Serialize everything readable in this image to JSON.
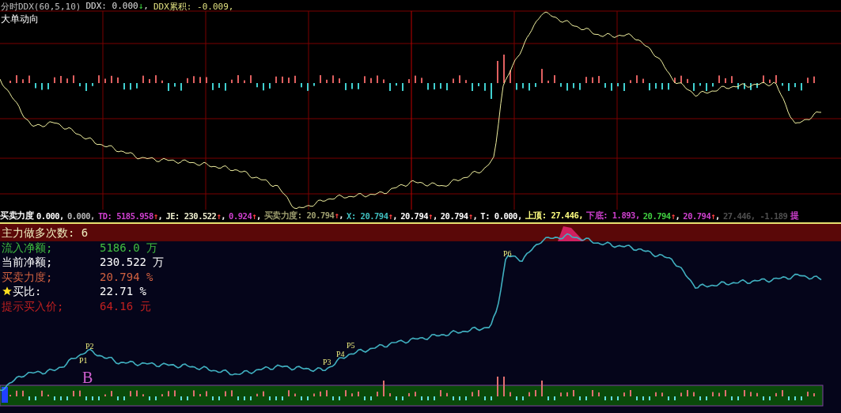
{
  "top_panel": {
    "indicator": "分时DDX(60,5,10)",
    "readouts": [
      {
        "label": "DDX:",
        "value": "0.000",
        "arrow": "↓",
        "tail": ",",
        "kind": "plain"
      },
      {
        "label": "DDX累积:",
        "value": "-0.009,",
        "kind": "accent"
      }
    ],
    "subtitle": "大单动向"
  },
  "info_bar": [
    {
      "text": "买卖力度",
      "color": "#ffffff"
    },
    {
      "text": "0.000,",
      "color": "#ffffff"
    },
    {
      "text": "0.000,",
      "color": "#b8b8b8"
    },
    {
      "text": "TD: 5185.958",
      "color": "#d040d0",
      "arrow": "↑",
      "tail": ","
    },
    {
      "text": "JE: 230.522",
      "color": "#f0f0d0",
      "arrow": "↑",
      "tail": ","
    },
    {
      "text": "0.924",
      "color": "#d040d0",
      "arrow": "↑",
      "tail": ","
    },
    {
      "text": "买卖力度: 20.794",
      "color": "#a0a070",
      "arrow": "↑",
      "tail": ","
    },
    {
      "text": "X: 20.794",
      "color": "#40c0c0",
      "arrow": "↑",
      "tail": ","
    },
    {
      "text": "20.794",
      "color": "#ffffff",
      "arrow": "↑",
      "tail": ","
    },
    {
      "text": "20.794",
      "color": "#ffffff",
      "arrow": "↑",
      "tail": ","
    },
    {
      "text": "T: 0.000,",
      "color": "#ffffff"
    },
    {
      "text": "上顶: 27.446,",
      "color": "#ffff80"
    },
    {
      "text": "下底: 1.893,",
      "color": "#d040d0"
    },
    {
      "text": "20.794",
      "color": "#40d040",
      "arrow": "↑",
      "tail": ","
    },
    {
      "text": "20.794",
      "color": "#d040d0",
      "arrow": "↑",
      "tail": ","
    },
    {
      "text": "27.446, -1.189",
      "color": "#505050"
    },
    {
      "text": "提",
      "color": "#d040d0"
    }
  ],
  "stats": {
    "header": "主力做多次数: 6",
    "rows": [
      {
        "label": "流入净额;",
        "value": "5186.0 万",
        "color": "#40c040",
        "kind": "plain"
      },
      {
        "label": "当前净额;",
        "value": "230.522 万",
        "color": "#ffffff",
        "kind": "plain"
      },
      {
        "label": "买卖力度;",
        "value": "20.794 %",
        "color": "#d06040",
        "kind": "plain"
      },
      {
        "label": "买比:",
        "value": "22.71 %",
        "color": "#ffffff",
        "kind": "star"
      },
      {
        "label": "提示买入价;",
        "value": "64.16 元",
        "color": "#c02020",
        "kind": "plain"
      }
    ]
  },
  "markers": [
    {
      "text": "P2",
      "kind": "point"
    },
    {
      "text": "P1",
      "kind": "point"
    },
    {
      "text": "B",
      "kind": "buy"
    },
    {
      "text": "P5",
      "kind": "point"
    },
    {
      "text": "P4",
      "kind": "point"
    },
    {
      "text": "P3",
      "kind": "point"
    },
    {
      "text": "P6",
      "kind": "point"
    }
  ]
}
